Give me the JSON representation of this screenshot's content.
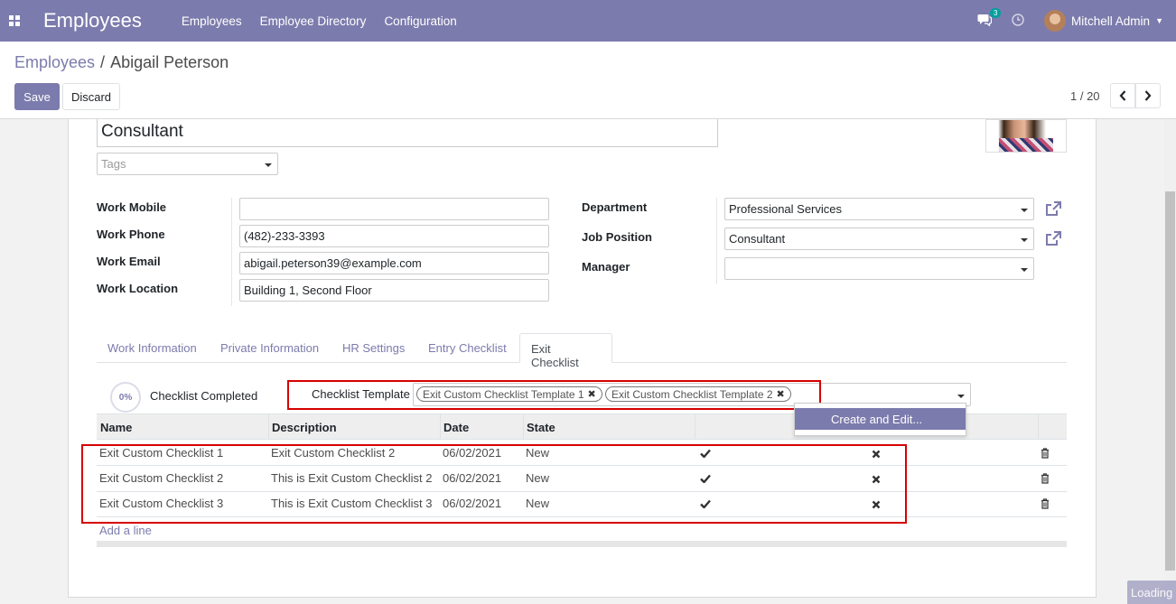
{
  "navbar": {
    "app_title": "Employees",
    "menu": [
      "Employees",
      "Employee Directory",
      "Configuration"
    ],
    "messages_badge": "3",
    "user_name": "Mitchell Admin",
    "color": "#7c7bad"
  },
  "breadcrumb": {
    "parent": "Employees",
    "separator": "/",
    "current": "Abigail Peterson"
  },
  "actions": {
    "save": "Save",
    "discard": "Discard"
  },
  "pager": {
    "value": "1 / 20"
  },
  "employee": {
    "job_title": "Consultant",
    "tags_placeholder": "Tags"
  },
  "work": {
    "mobile_label": "Work Mobile",
    "mobile_value": "",
    "phone_label": "Work Phone",
    "phone_value": "(482)-233-3393",
    "email_label": "Work Email",
    "email_value": "abigail.peterson39@example.com",
    "location_label": "Work Location",
    "location_value": "Building 1, Second Floor",
    "department_label": "Department",
    "department_value": "Professional Services",
    "job_position_label": "Job Position",
    "job_position_value": "Consultant",
    "manager_label": "Manager",
    "manager_value": ""
  },
  "tabs": [
    {
      "label": "Work Information",
      "active": false
    },
    {
      "label": "Private Information",
      "active": false
    },
    {
      "label": "HR Settings",
      "active": false
    },
    {
      "label": "Entry Checklist",
      "active": false
    },
    {
      "label": "Exit Checklist",
      "active": true
    }
  ],
  "checklist": {
    "progress": "0%",
    "completed_label": "Checklist Completed",
    "template_label": "Checklist Template",
    "template_tags": [
      "Exit Custom Checklist Template 1",
      "Exit Custom Checklist Template 2"
    ],
    "dropdown_option": "Create and Edit..."
  },
  "table": {
    "headers": [
      "Name",
      "Description",
      "Date",
      "State"
    ],
    "rows": [
      {
        "name": "Exit Custom Checklist 1",
        "description": "Exit Custom Checklist 2",
        "date": "06/02/2021",
        "state": "New"
      },
      {
        "name": "Exit Custom Checklist 2",
        "description": "This is Exit Custom Checklist 2",
        "date": "06/02/2021",
        "state": "New"
      },
      {
        "name": "Exit Custom Checklist 3",
        "description": "This is Exit Custom Checklist 3",
        "date": "06/02/2021",
        "state": "New"
      }
    ],
    "add_line": "Add a line"
  },
  "status": {
    "loading": "Loading"
  },
  "icons": {
    "apps": "apps-grid-icon",
    "chat": "chat-icon",
    "clock": "clock-icon",
    "external_link": "external-link-icon",
    "check": "check-icon",
    "remove": "x-icon",
    "trash": "trash-icon"
  }
}
